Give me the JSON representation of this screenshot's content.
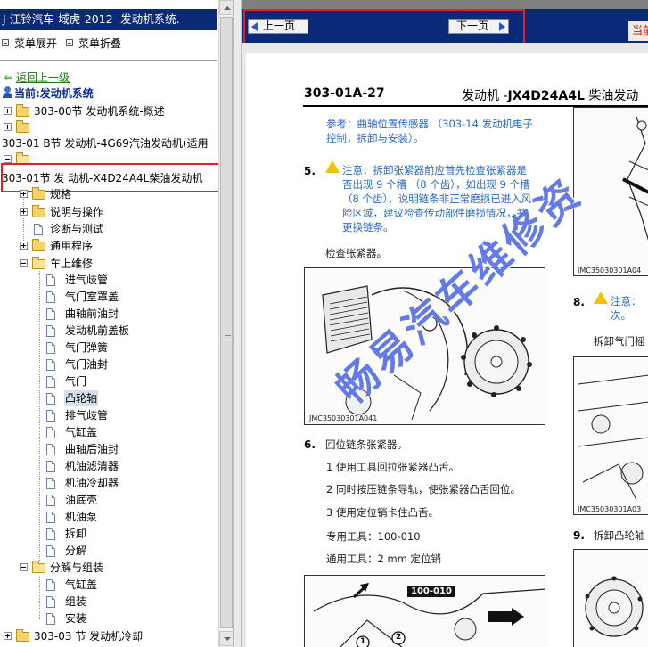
{
  "left_pane": {
    "title": "J-江铃汽车-域虎-2012- 发动机系统.",
    "menu": {
      "expand": "菜单展开",
      "collapse": "菜单折叠"
    },
    "back": "返回上一级",
    "current": "当前:发动机系统",
    "tree": [
      {
        "label": "303-00节 发动机系统-概述"
      },
      {
        "label": ""
      },
      {
        "label": "303-01 B节 发动机-4G69汽油发动机(适用"
      },
      {
        "label": ""
      },
      {
        "label": "303-01节 发 动机-X4D24A4L柴油发动机"
      },
      {
        "label": "规格"
      },
      {
        "label": "说明与操作"
      },
      {
        "label": "诊断与测试"
      },
      {
        "label": "通用程序"
      },
      {
        "label": "车上维修"
      },
      {
        "label": "进气歧管"
      },
      {
        "label": "气门室罩盖"
      },
      {
        "label": "曲轴前油封"
      },
      {
        "label": "发动机前盖板"
      },
      {
        "label": "气门弹簧"
      },
      {
        "label": "气门油封"
      },
      {
        "label": "气门"
      },
      {
        "label": "凸轮轴"
      },
      {
        "label": "排气歧管"
      },
      {
        "label": "气缸盖"
      },
      {
        "label": "曲轴后油封"
      },
      {
        "label": "机油滤清器"
      },
      {
        "label": "机油冷却器"
      },
      {
        "label": "油底壳"
      },
      {
        "label": "机油泵"
      },
      {
        "label": "拆卸"
      },
      {
        "label": "分解"
      },
      {
        "label": "分解与组装"
      },
      {
        "label": "气缸盖"
      },
      {
        "label": "组装"
      },
      {
        "label": "安装"
      },
      {
        "label": "303-03 节 发动机冷却"
      }
    ]
  },
  "nav": {
    "prev": "上一页",
    "next": "下一页",
    "right_red": "当前"
  },
  "document": {
    "page_number": "303-01A-27",
    "title_prefix": "发动机 -",
    "title_model": "JX4D24A4L",
    "title_suffix": " 柴油发动",
    "ref_line1": "参考：曲轴位置传感器 （303-14 发动机电子",
    "ref_line2": "控制，拆卸与安装）。",
    "step5_num": "5.",
    "step5_l1": "注意：拆卸张紧器前应首先检查张紧器是",
    "step5_l2": "否出现 9 个槽 （8 个齿），如出现 9 个槽",
    "step5_l3": "（8 个齿），说明链条非正常磨损已进入风",
    "step5_l4": "险区域，建议检查传动部件磨损情况，并",
    "step5_l5": "更换链条。",
    "check_tensioner": "检查张紧器。",
    "fig1_caption": "JMC35030301A041",
    "fig_top_right_caption": "JMC35030301A04",
    "step8_num": "8.",
    "step8_warn1": "注意：",
    "step8_warn2": "次。",
    "step8_text": "拆卸气门摇",
    "fig_mid_right_caption": "JMC35030301A03",
    "step9_num": "9.",
    "step9_text": "拆卸凸轮轴",
    "step6_num": "6.",
    "step6_title": "回位链条张紧器。",
    "step6_s1": "1 使用工具回拉张紧器凸舌。",
    "step6_s2": "2 同时按压链条导轨，使张紧器凸舌回位。",
    "step6_s3": "3 使用定位销卡住凸舌。",
    "step6_tool_label": "专用工具：",
    "step6_tool_value": "100-010",
    "step6_pin": "通用工具：2 mm 定位销",
    "fig3_tool_tag": "100-010",
    "fig3_num1": "1",
    "fig3_num2": "2"
  },
  "watermark": "畅易汽车维修资",
  "colors": {
    "title_bar": "#0a2a78",
    "highlight_red": "#e0202a",
    "link_green": "#1a7a10",
    "current_blue": "#0a2a9c",
    "doc_blue": "#2a6bc8",
    "watermark": "#2846dc"
  }
}
